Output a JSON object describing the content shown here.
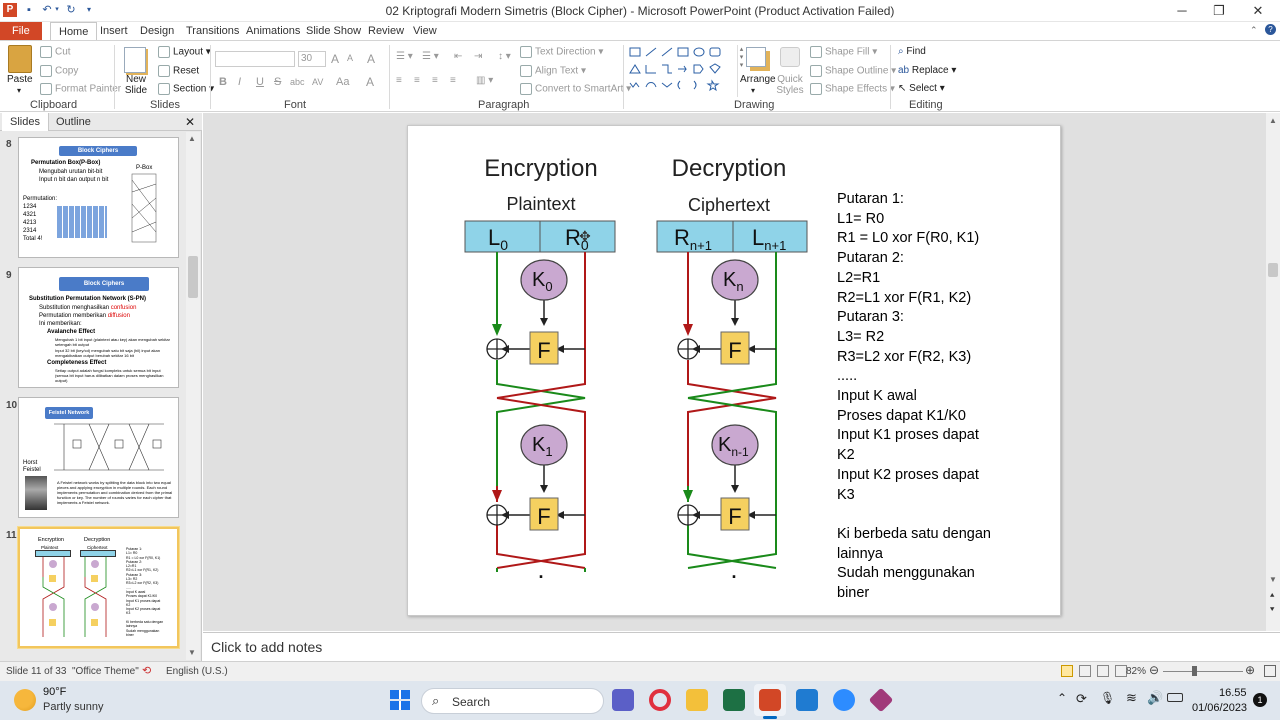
{
  "window": {
    "title": "02 Kriptografi Modern Simetris (Block Cipher)  -  Microsoft PowerPoint (Product Activation Failed)",
    "minimize": "─",
    "restore": "❐",
    "close": "✕"
  },
  "tabs": [
    "File",
    "Home",
    "Insert",
    "Design",
    "Transitions",
    "Animations",
    "Slide Show",
    "Review",
    "View"
  ],
  "ribbon": {
    "clipboard": {
      "paste": "Paste",
      "cut": "Cut",
      "copy": "Copy",
      "format_painter": "Format Painter",
      "label": "Clipboard"
    },
    "slides": {
      "new_slide": "New Slide",
      "layout": "Layout",
      "reset": "Reset",
      "section": "Section",
      "label": "Slides"
    },
    "font": {
      "size": "30",
      "label": "Font",
      "bold": "B",
      "italic": "I",
      "underline": "U",
      "strike": "S",
      "shadow": "abc",
      "spacing": "AV",
      "case": "Aa",
      "color": "A",
      "grow": "A",
      "shrink": "A",
      "clear": "A"
    },
    "paragraph": {
      "text_direction": "Text Direction",
      "align_text": "Align Text",
      "convert_smartart": "Convert to SmartArt",
      "label": "Paragraph"
    },
    "drawing": {
      "arrange": "Arrange",
      "quick_styles": "Quick Styles",
      "shape_fill": "Shape Fill",
      "shape_outline": "Shape Outline",
      "shape_effects": "Shape Effects",
      "label": "Drawing"
    },
    "editing": {
      "find": "Find",
      "replace": "Replace",
      "select": "Select",
      "label": "Editing"
    }
  },
  "pane": {
    "tab_slides": "Slides",
    "tab_outline": "Outline",
    "close": "✕"
  },
  "thumbs": [
    {
      "num": "8",
      "title": "Block Ciphers",
      "bullet1": "Permutation Box(P-Box)",
      "sub1": "Mengubah urutan bit-bit",
      "sub2": "Input n bit dan output n bit",
      "perm": "Permutation:",
      "rows": [
        "1234",
        "4321",
        "4213",
        "2314",
        "Total 4!"
      ],
      "pbox": "P-Box"
    },
    {
      "num": "9",
      "title": "Block Ciphers",
      "bullet1": "Substitution Permutation Network (S-PN)",
      "l1": "Substitution menghasilkan",
      "l1r": "confusion",
      "l2": "Permutation memberikan",
      "l2r": "diffusion",
      "l3": "Ini memberikan:",
      "l4": "Avalanche Effect",
      "l5": "Mengubah 1 bit input (plaintext atau key) akan mengubah sekitar setengah bit output",
      "l6": "Input 32 bit (key/cd) mengubah satu bit saja (hil) input akan mengakibatkan output berubah sekitar 16 bit",
      "l7": "Completeness Effect",
      "l8": "Setiap output adalah fungsi kompleks untuk semua bit input (semua bit input harus dilibatkan dalam proses menghasilkan output)"
    },
    {
      "num": "10",
      "title": "Feistel Network",
      "name": "Horst Feistel",
      "desc": "A Feistel network works by splitting the data block into two equal pieces and applying encryption in multiple rounds. Each round implements permutation and combination derived from the primal function or key. The number of rounds varies for each cipher that implements a Feistel network."
    },
    {
      "num": "11"
    }
  ],
  "slide": {
    "enc_title": "Encryption",
    "dec_title": "Decryption",
    "plaintext": "Plaintext",
    "ciphertext": "Ciphertext",
    "L0": "L",
    "L0sub": "0",
    "R0": "R",
    "R0sub": "0",
    "Rn1": "R",
    "Rn1sub": "n+1",
    "Ln1": "L",
    "Ln1sub": "n+1",
    "K0": "K",
    "K0sub": "0",
    "K1": "K",
    "K1sub": "1",
    "Kn": "K",
    "Knsub": "n",
    "Kn1": "K",
    "Kn1sub": "n-1",
    "F": "F",
    "dot": ".",
    "notes": "Putaran 1:\nL1= R0\nR1 = L0 xor F(R0, K1)\nPutaran 2:\nL2=R1\nR2=L1 xor F(R1, K2)\nPutaran 3:\nL3= R2\nR3=L2 xor F(R2, K3)\n.....\nInput K awal\nProses dapat K1/K0\nInput K1 proses dapat\nK2\nInput K2 proses dapat\nK3\n\nKi berbeda satu dengan\nlainnya\nSudah menggunakan\nbiner"
  },
  "notes_placeholder": "Click to add notes",
  "status": {
    "slide": "Slide 11 of 33",
    "theme": "\"Office Theme\"",
    "lang": "English (U.S.)",
    "zoom": "82%"
  },
  "taskbar": {
    "temp": "90°F",
    "weather": "Partly sunny",
    "search": "Search",
    "time": "16.55",
    "date": "01/06/2023",
    "notif": "1"
  },
  "colors": {
    "file_tab": "#d24726",
    "accent_green": "#1a8a1a",
    "accent_red": "#b01818",
    "box_blue": "#8fd3e8",
    "f_box": "#f5d060",
    "key_purple": "#c9a8d0"
  }
}
